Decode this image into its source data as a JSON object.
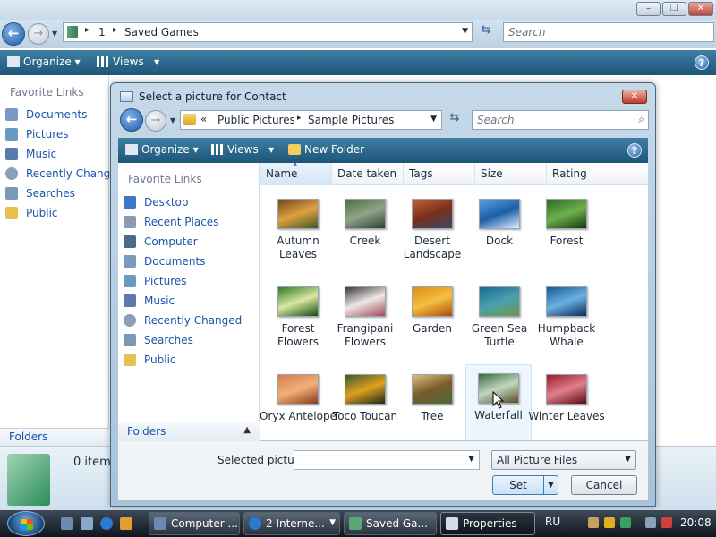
{
  "bg_window": {
    "crumbs": [
      "1",
      "Saved Games"
    ],
    "search_placeholder": "Search",
    "toolbar": {
      "organize": "Organize",
      "views": "Views",
      "help": "?"
    },
    "favorites_title": "Favorite Links",
    "favorites": [
      "Documents",
      "Pictures",
      "Music",
      "Recently Changed",
      "Searches",
      "Public"
    ],
    "folders_label": "Folders",
    "details_text": "0 item"
  },
  "dialog": {
    "title": "Select a picture for Contact",
    "close": "✕",
    "address": {
      "prefix": "«",
      "crumbs": [
        "Public Pictures",
        "Sample Pictures"
      ]
    },
    "search_placeholder": "Search",
    "toolbar": {
      "organize": "Organize",
      "views": "Views",
      "new_folder": "New Folder",
      "help": "?"
    },
    "favorites_title": "Favorite Links",
    "favorites": [
      "Desktop",
      "Recent Places",
      "Computer",
      "Documents",
      "Pictures",
      "Music",
      "Recently Changed",
      "Searches",
      "Public"
    ],
    "folders_label": "Folders",
    "columns": [
      "Name",
      "Date taken",
      "Tags",
      "Size",
      "Rating"
    ],
    "items": [
      {
        "label": "Autumn Leaves",
        "colors": [
          "#6b4a1c",
          "#e0a040",
          "#3e5a26"
        ]
      },
      {
        "label": "Creek",
        "colors": [
          "#4f6f3e",
          "#8fa48a",
          "#2e4030"
        ]
      },
      {
        "label": "Desert Landscape",
        "colors": [
          "#c0643a",
          "#7a2e1a",
          "#3a4a6a"
        ]
      },
      {
        "label": "Dock",
        "colors": [
          "#5aa0e0",
          "#1c5ea8",
          "#dfefff"
        ]
      },
      {
        "label": "Forest",
        "colors": [
          "#2a6a2a",
          "#6fb04a",
          "#123812"
        ]
      },
      {
        "label": "Forest Flowers",
        "colors": [
          "#2f7a2a",
          "#d8e8a0",
          "#164a14"
        ]
      },
      {
        "label": "Frangipani Flowers",
        "colors": [
          "#3a3a3a",
          "#f0e6e6",
          "#a04a5a"
        ]
      },
      {
        "label": "Garden",
        "colors": [
          "#e08a10",
          "#f4c040",
          "#b04a10"
        ]
      },
      {
        "label": "Green Sea Turtle",
        "colors": [
          "#1a6a8a",
          "#4aa0b0",
          "#6a9a4a"
        ]
      },
      {
        "label": "Humpback Whale",
        "colors": [
          "#1a5a9a",
          "#6ab0e0",
          "#0a2a5a"
        ]
      },
      {
        "label": "Oryx Antelope",
        "colors": [
          "#d87a4a",
          "#f0b07a",
          "#8a3a1a"
        ]
      },
      {
        "label": "Toco Toucan",
        "colors": [
          "#3a5a2a",
          "#e0a020",
          "#1a2a1a"
        ]
      },
      {
        "label": "Tree",
        "colors": [
          "#e0c080",
          "#7a5a2a",
          "#4a6a3a"
        ]
      },
      {
        "label": "Waterfall",
        "colors": [
          "#3a6a3a",
          "#c0d8c0",
          "#5a4a2a"
        ]
      },
      {
        "label": "Winter Leaves",
        "colors": [
          "#9a1a2a",
          "#e0808a",
          "#5a0a14"
        ]
      }
    ],
    "selected_label": "Selected picture:",
    "selected_value": "",
    "filter": "All Picture Files",
    "set_button": "Set",
    "cancel_button": "Cancel"
  },
  "taskbar": {
    "buttons": [
      {
        "label": "Computer ...",
        "color": "#6a8ab0"
      },
      {
        "label": "2 Interne...",
        "color": "#2a7ad0"
      },
      {
        "label": "Saved Ga...",
        "color": "#5aa67a"
      },
      {
        "label": "Properties",
        "color": "#d0dcea"
      }
    ],
    "language": "RU",
    "time": "20:08"
  }
}
